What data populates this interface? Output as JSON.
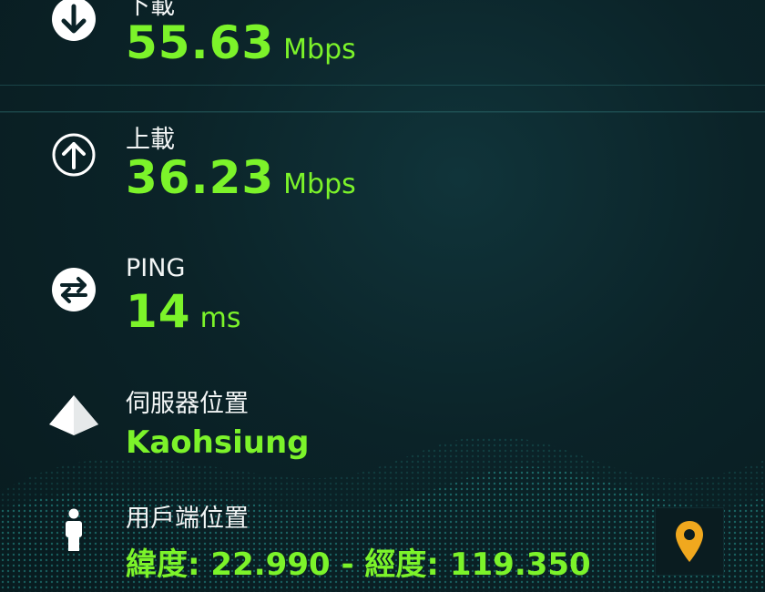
{
  "accent_color": "#7cf32a",
  "download": {
    "label": "下載",
    "value": "55.63",
    "unit": "Mbps",
    "icon": "arrow-down-circle-icon"
  },
  "upload": {
    "label": "上載",
    "value": "36.23",
    "unit": "Mbps",
    "icon": "arrow-up-circle-icon"
  },
  "ping": {
    "label": "PING",
    "value": "14",
    "unit": "ms",
    "icon": "swap-arrows-circle-icon"
  },
  "server": {
    "label": "伺服器位置",
    "value": "Kaohsiung",
    "icon": "pyramid-icon"
  },
  "client": {
    "label": "用戶端位置",
    "value": "緯度: 22.990 - 經度: 119.350",
    "icon": "person-icon"
  },
  "map_button": {
    "icon": "map-pin-icon",
    "pin_color": "#f0a81e"
  }
}
